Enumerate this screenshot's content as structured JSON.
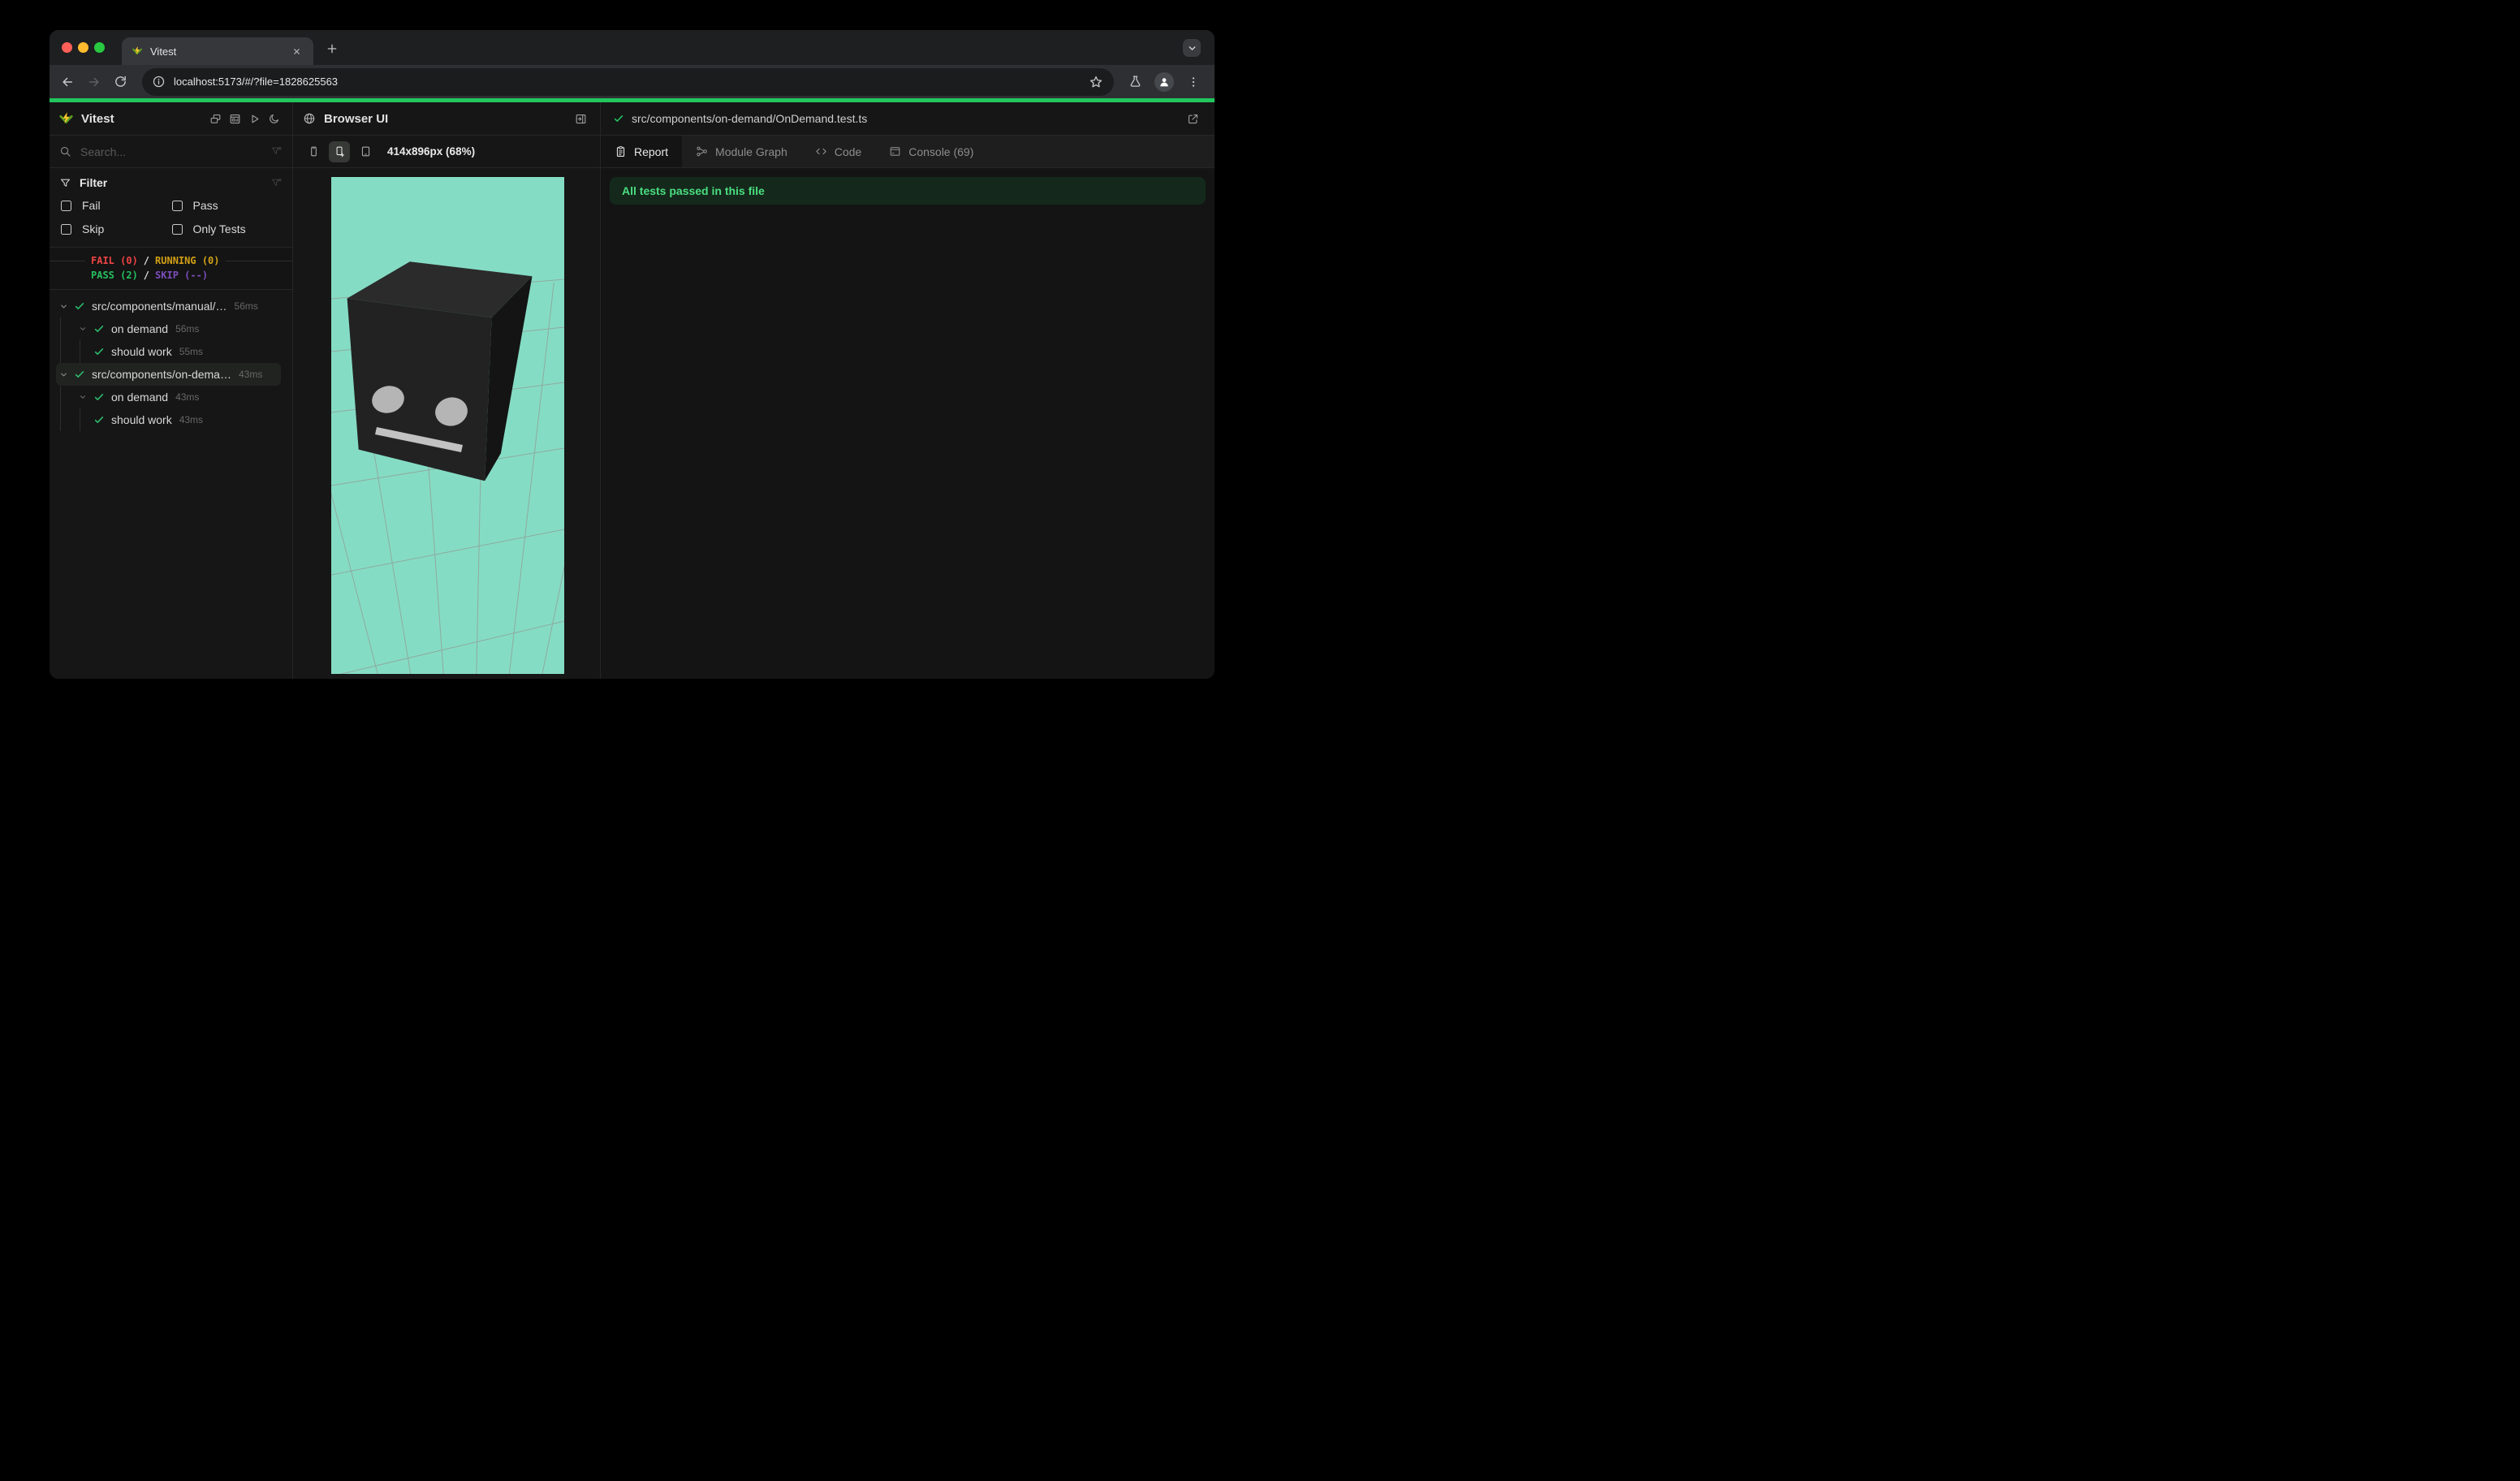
{
  "browser": {
    "tab_title": "Vitest",
    "url": "localhost:5173/#/?file=1828625563",
    "new_tab_label": "+"
  },
  "colors": {
    "traffic_close": "#ff5f57",
    "traffic_minimize": "#febc2e",
    "traffic_maximize": "#28c840",
    "progress_green": "#22c55e",
    "viewport_mint": "#85dcc4",
    "fail_red": "#ef4444",
    "running_yellow": "#d4a017",
    "pass_green": "#25c05f",
    "skip_purple": "#7c4dbc",
    "banner_green": "#4ade80"
  },
  "sidebar": {
    "brand": "Vitest",
    "search_placeholder": "Search...",
    "filter": {
      "title": "Filter",
      "options": [
        "Fail",
        "Pass",
        "Skip",
        "Only Tests"
      ]
    },
    "stats": {
      "fail": "FAIL (0)",
      "sep": "/",
      "running": "RUNNING (0)",
      "pass": "PASS (2)",
      "skip": "SKIP (--)"
    },
    "tree": [
      {
        "label": "src/components/manual/…",
        "duration": "56ms"
      },
      {
        "label": "on demand",
        "duration": "56ms"
      },
      {
        "label": "should work",
        "duration": "55ms"
      },
      {
        "label": "src/components/on-dema…",
        "duration": "43ms"
      },
      {
        "label": "on demand",
        "duration": "43ms"
      },
      {
        "label": "should work",
        "duration": "43ms"
      }
    ]
  },
  "preview": {
    "title": "Browser UI",
    "viewport_label": "414x896px (68%)"
  },
  "report": {
    "file_path": "src/components/on-demand/OnDemand.test.ts",
    "tabs": [
      {
        "label": "Report"
      },
      {
        "label": "Module Graph"
      },
      {
        "label": "Code"
      },
      {
        "label": "Console (69)"
      }
    ],
    "banner": "All tests passed in this file"
  }
}
